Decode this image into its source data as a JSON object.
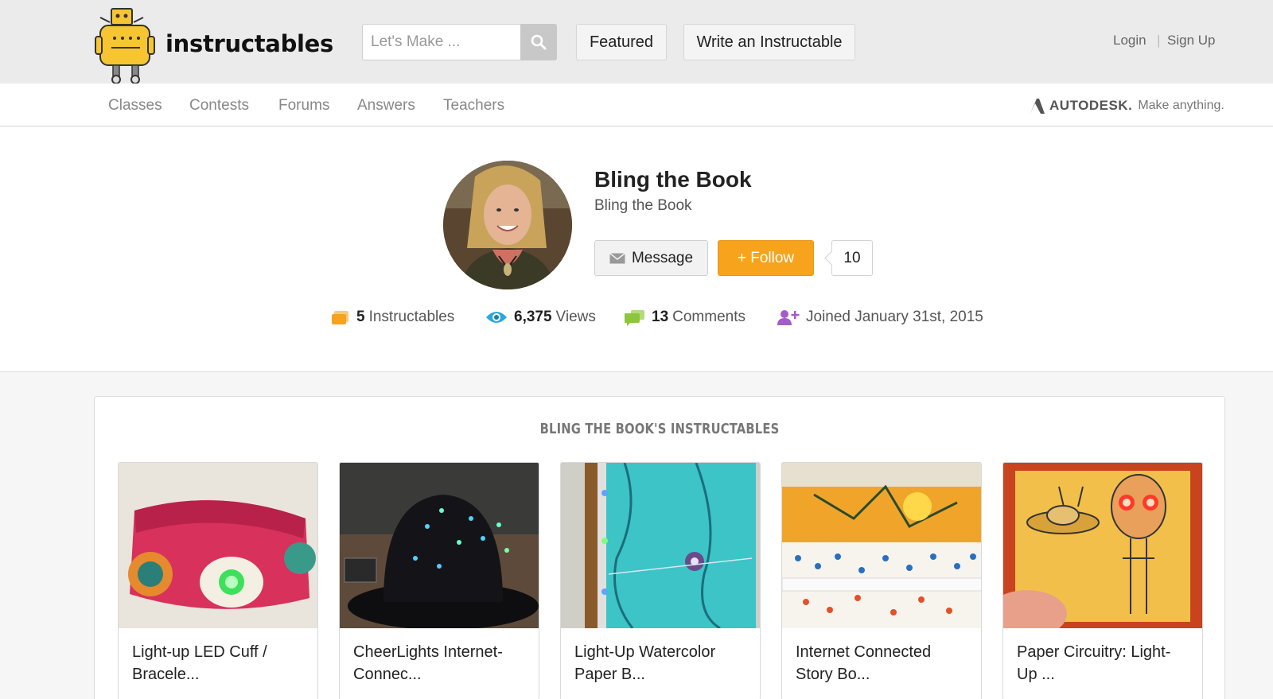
{
  "header": {
    "brand": "instructables",
    "search_placeholder": "Let's Make ...",
    "featured_label": "Featured",
    "write_label": "Write an Instructable",
    "login_label": "Login",
    "separator": "|",
    "signup_label": "Sign Up"
  },
  "nav": {
    "items": [
      "Classes",
      "Contests",
      "Forums",
      "Answers",
      "Teachers"
    ],
    "autodesk_name": "AUTODESK.",
    "autodesk_tagline": "Make anything."
  },
  "profile": {
    "name": "Bling the Book",
    "subtitle": "Bling the Book",
    "message_label": "Message",
    "follow_label": "+ Follow",
    "follower_count": "10",
    "stats": {
      "instructables_count": "5",
      "instructables_label": "Instructables",
      "views_count": "6,375",
      "views_label": "Views",
      "comments_count": "13",
      "comments_label": "Comments",
      "joined_label": "Joined January 31st, 2015"
    }
  },
  "instructables": {
    "section_title": "BLING THE BOOK'S INSTRUCTABLES",
    "items": [
      {
        "title_line1": "Light-up LED Cuff /",
        "title_line2": "Bracele..."
      },
      {
        "title_line1": "CheerLights Internet-",
        "title_line2": "Connec..."
      },
      {
        "title_line1": "Light-Up Watercolor",
        "title_line2": "Paper B..."
      },
      {
        "title_line1": "Internet Connected",
        "title_line2": "Story Bo..."
      },
      {
        "title_line1": "Paper Circuitry: Light-",
        "title_line2": "Up ..."
      }
    ]
  },
  "colors": {
    "accent": "#f7a31c",
    "views_icon": "#2aa7dd",
    "comments_icon": "#8cc63f",
    "joined_icon": "#a35dc9"
  }
}
